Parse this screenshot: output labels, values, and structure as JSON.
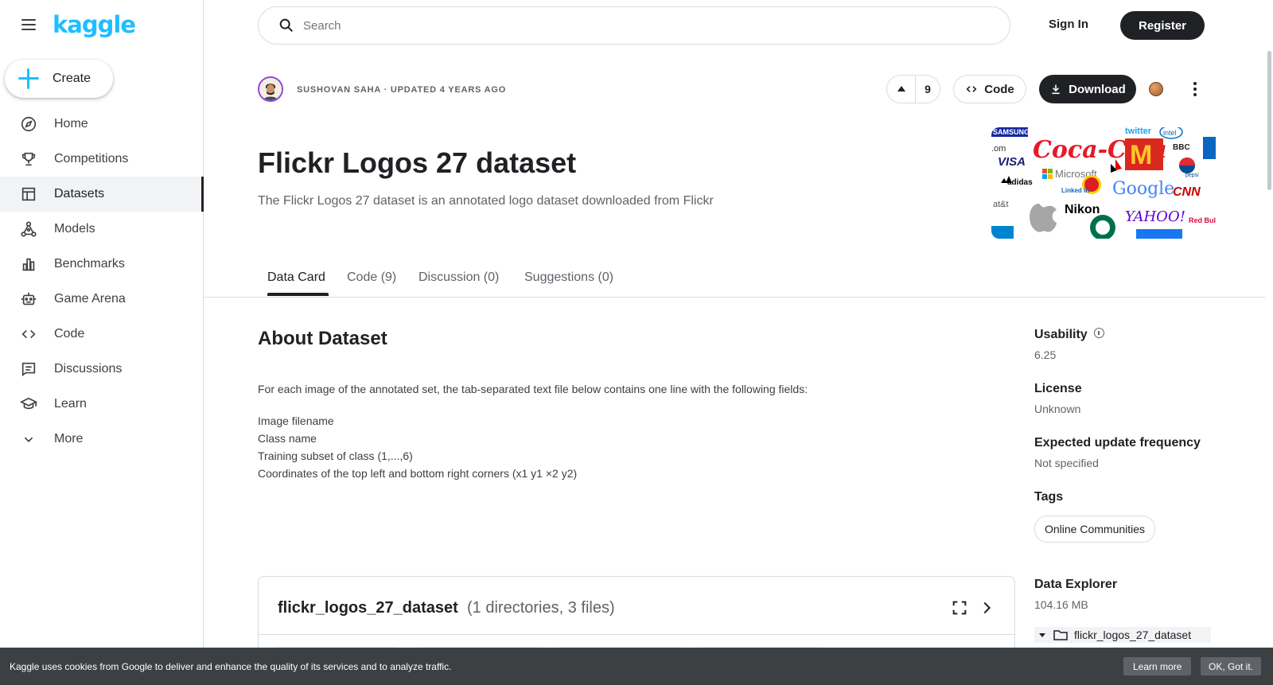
{
  "app": {
    "logo_text": "kaggle",
    "brand_color": "#20beff"
  },
  "sidebar": {
    "create_label": "Create",
    "items": [
      {
        "label": "Home",
        "icon": "compass-icon",
        "active": false
      },
      {
        "label": "Competitions",
        "icon": "trophy-icon",
        "active": false
      },
      {
        "label": "Datasets",
        "icon": "table-icon",
        "active": true
      },
      {
        "label": "Models",
        "icon": "models-icon",
        "active": false
      },
      {
        "label": "Benchmarks",
        "icon": "bar-chart-icon",
        "active": false
      },
      {
        "label": "Game Arena",
        "icon": "robot-icon",
        "active": false
      },
      {
        "label": "Code",
        "icon": "code-icon",
        "active": false
      },
      {
        "label": "Discussions",
        "icon": "comment-icon",
        "active": false
      },
      {
        "label": "Learn",
        "icon": "school-icon",
        "active": false
      },
      {
        "label": "More",
        "icon": "chevron-down-icon",
        "active": false
      }
    ]
  },
  "header": {
    "search_placeholder": "Search",
    "sign_in": "Sign In",
    "register": "Register"
  },
  "dataset": {
    "author_line": "SUSHOVAN SAHA · UPDATED 4 YEARS AGO",
    "vote_count": "9",
    "code_label": "Code",
    "download_label": "Download",
    "title": "Flickr Logos 27 dataset",
    "subtitle": "The Flickr Logos 27 dataset is an annotated logo dataset downloaded from Flickr",
    "cover_brands": [
      "SAMSUNG",
      "Coca-Cola",
      "twitter",
      "intel",
      "VISA",
      "M",
      "BBC",
      "Microsoft",
      "adidas",
      "Google",
      "CNN",
      "Nikon",
      "YAHOO!",
      "Red Bull",
      "at&t",
      "Linked in",
      "pepsi"
    ]
  },
  "tabs": [
    {
      "label": "Data Card",
      "active": true
    },
    {
      "label": "Code (9)",
      "active": false
    },
    {
      "label": "Discussion (0)",
      "active": false
    },
    {
      "label": "Suggestions (0)",
      "active": false
    }
  ],
  "about": {
    "title": "About Dataset",
    "intro": "For each image of the annotated set, the tab-separated text file below contains one line with the following fields:",
    "fields": [
      "Image filename",
      "Class name",
      "Training subset of class (1,...,6)",
      "Coordinates of the top left and bottom right corners (x1 y1 ×2 y2)"
    ]
  },
  "file_card": {
    "name": "flickr_logos_27_dataset",
    "count": "(1 directories, 3 files)"
  },
  "meta": {
    "usability_label": "Usability",
    "usability_value": "6.25",
    "license_label": "License",
    "license_value": "Unknown",
    "frequency_label": "Expected update frequency",
    "frequency_value": "Not specified",
    "tags_label": "Tags",
    "tags": [
      "Online Communities"
    ],
    "explorer_label": "Data Explorer",
    "explorer_size": "104.16 MB",
    "explorer_root": "flickr_logos_27_dataset"
  },
  "cookie": {
    "text": "Kaggle uses cookies from Google to deliver and enhance the quality of its services and to analyze traffic.",
    "learn_more": "Learn more",
    "ok": "OK, Got it."
  }
}
